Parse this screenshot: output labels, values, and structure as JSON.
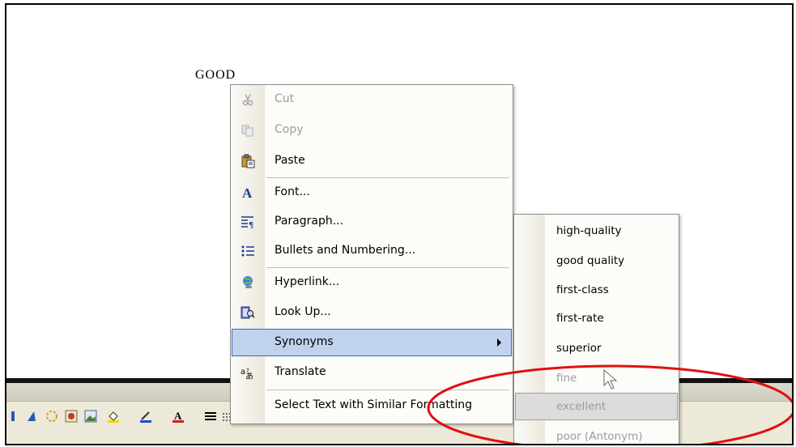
{
  "document": {
    "word": "GOOD"
  },
  "context_menu": {
    "items": [
      {
        "label": "Cut",
        "icon": "cut-icon",
        "disabled": true
      },
      {
        "label": "Copy",
        "icon": "copy-icon",
        "disabled": true
      },
      {
        "label": "Paste",
        "icon": "paste-icon",
        "disabled": false
      },
      {
        "label": "Font...",
        "icon": "font-icon",
        "disabled": false
      },
      {
        "label": "Paragraph...",
        "icon": "paragraph-icon",
        "disabled": false
      },
      {
        "label": "Bullets and Numbering...",
        "icon": "bullets-icon",
        "disabled": false
      },
      {
        "label": "Hyperlink...",
        "icon": "hyperlink-icon",
        "disabled": false
      },
      {
        "label": "Look Up...",
        "icon": "lookup-icon",
        "disabled": false
      },
      {
        "label": "Synonyms",
        "icon": "",
        "disabled": false,
        "highlighted": true,
        "has_submenu": true
      },
      {
        "label": "Translate",
        "icon": "translate-icon",
        "disabled": false
      },
      {
        "label": "Select Text with Similar Formatting",
        "icon": "",
        "disabled": false
      }
    ]
  },
  "synonyms_submenu": {
    "items": [
      {
        "label": "high-quality",
        "disabled": false
      },
      {
        "label": "good quality",
        "disabled": false
      },
      {
        "label": "first-class",
        "disabled": false
      },
      {
        "label": "first-rate",
        "disabled": false
      },
      {
        "label": "superior",
        "disabled": false
      },
      {
        "label": "fine",
        "disabled": true
      },
      {
        "label": "excellent",
        "disabled": true,
        "highlighted": true
      },
      {
        "label": "poor (Antonym)",
        "disabled": true
      }
    ]
  },
  "annotation": {
    "ellipse_color": "#e01010"
  },
  "colors": {
    "menu_highlight": "#c1d2ee",
    "highlight_border": "#316ac5",
    "disabled_text": "#9c9c9c"
  }
}
